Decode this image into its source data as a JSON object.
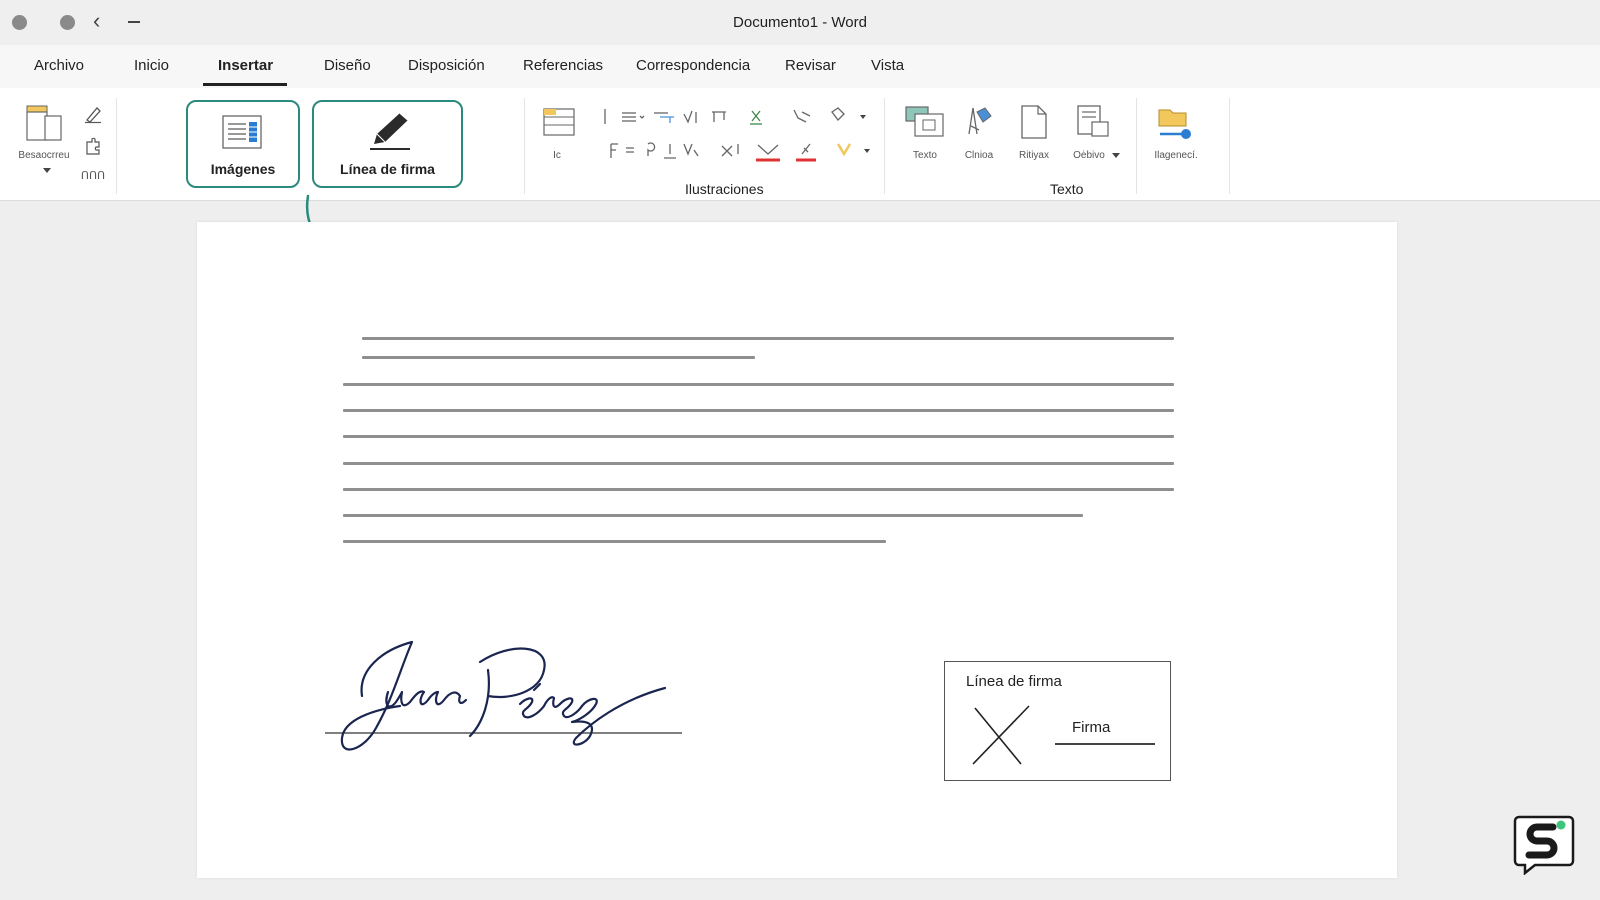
{
  "window": {
    "title": "Documento1 - Word"
  },
  "tabs": [
    {
      "label": "Archivo"
    },
    {
      "label": "Inicio"
    },
    {
      "label": "Insertar"
    },
    {
      "label": "Diseño"
    },
    {
      "label": "Disposición"
    },
    {
      "label": "Referencias"
    },
    {
      "label": "Correspondencia"
    },
    {
      "label": "Revisar"
    },
    {
      "label": "Vista"
    }
  ],
  "active_tab": "Insertar",
  "ribbon": {
    "left_group": {
      "label": "Besaocrreu"
    },
    "left_small": {
      "label": "ՈՈՈ"
    },
    "images_button": {
      "label": "Imágenes"
    },
    "signature_button": {
      "label": "Línea de firma"
    },
    "table": {
      "label": "Ic"
    },
    "groups": {
      "illustrations": "Ilustraciones",
      "text": "Texto"
    },
    "text_items": [
      {
        "label": "Texto"
      },
      {
        "label": "Clnioa"
      },
      {
        "label": "Ritiyax"
      },
      {
        "label": "Oėbivo"
      }
    ],
    "media": {
      "label": "Ilagenecí."
    }
  },
  "document": {
    "handwritten_signature": "Juan Pérez",
    "signature_box": {
      "title": "Línea de firma",
      "mark": "X",
      "placeholder": "Firma"
    }
  },
  "colors": {
    "accent": "#2a8a7c",
    "signature_ink": "#1a2550",
    "underline_red": "#e03030",
    "folder_yellow": "#f2c75c",
    "media_blue": "#2b7cd3"
  }
}
